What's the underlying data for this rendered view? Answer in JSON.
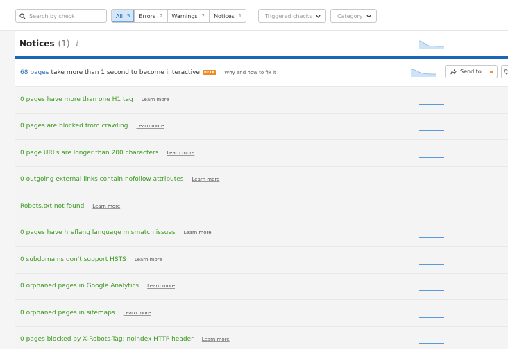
{
  "search": {
    "placeholder": "Search by check"
  },
  "filters": [
    {
      "label": "All",
      "count": "5"
    },
    {
      "label": "Errors",
      "count": "2"
    },
    {
      "label": "Warnings",
      "count": "2"
    },
    {
      "label": "Notices",
      "count": "1"
    }
  ],
  "dropdowns": {
    "triggered": "Triggered checks",
    "category": "Category"
  },
  "section": {
    "title": "Notices",
    "count": "(1)",
    "info": "i"
  },
  "first_issue": {
    "count_link": "68 pages",
    "text": "take more than 1 second to become interactive",
    "badge": "BETA",
    "why": "Why and how to fix it",
    "send": "Send to..."
  },
  "issues": [
    {
      "text": "0 pages have more than one H1 tag",
      "learn": "Learn more"
    },
    {
      "text": "0 pages are blocked from crawling",
      "learn": "Learn more"
    },
    {
      "text": "0 page URLs are longer than 200 characters",
      "learn": "Learn more"
    },
    {
      "text": "0 outgoing external links contain nofollow attributes",
      "learn": "Learn more"
    },
    {
      "text": "Robots.txt not found",
      "learn": "Learn more"
    },
    {
      "text": "0 pages have hreflang language mismatch issues",
      "learn": "Learn more"
    },
    {
      "text": "0 subdomains don't support HSTS",
      "learn": "Learn more"
    },
    {
      "text": "0 orphaned pages in Google Analytics",
      "learn": "Learn more"
    },
    {
      "text": "0 orphaned pages in sitemaps",
      "learn": "Learn more"
    },
    {
      "text": "0 pages blocked by X-Robots-Tag: noindex HTTP header",
      "learn": "Learn more"
    }
  ],
  "colors": {
    "accent": "#1a66b8",
    "ok_text": "#3a9a1e",
    "badge": "#f08a24",
    "link": "#2b6cb0"
  }
}
